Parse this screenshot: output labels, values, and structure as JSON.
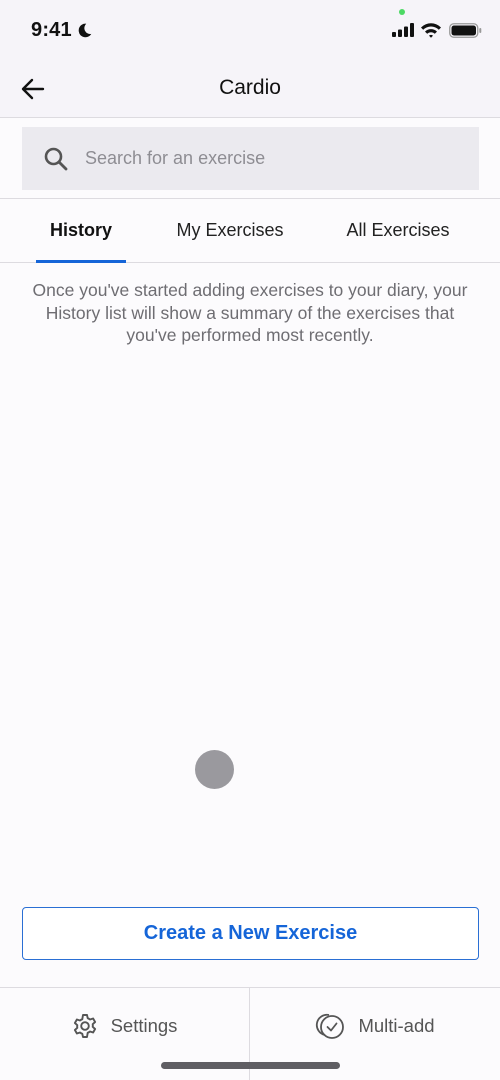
{
  "status_bar": {
    "time": "9:41",
    "icons": [
      "moon-icon",
      "signal-icon",
      "wifi-icon",
      "battery-icon"
    ]
  },
  "nav": {
    "title": "Cardio",
    "back_icon": "arrow-left-icon"
  },
  "search": {
    "placeholder": "Search for an exercise",
    "value": "",
    "icon": "search-icon"
  },
  "tabs": [
    {
      "label": "History",
      "active": true
    },
    {
      "label": "My Exercises",
      "active": false
    },
    {
      "label": "All Exercises",
      "active": false
    }
  ],
  "empty_message": "Once you've started adding exercises to your diary, your History list will show a summary of the exercises that you've performed most recently.",
  "create_button": {
    "label": "Create a New Exercise"
  },
  "bottom_bar": {
    "settings": {
      "label": "Settings",
      "icon": "gear-icon"
    },
    "multi_add": {
      "label": "Multi-add",
      "icon": "multi-check-icon"
    }
  },
  "colors": {
    "accent": "#1565d8",
    "background": "#fcfbfd",
    "header_bg": "#f6f4f9",
    "search_bg": "#ebeaef",
    "muted_text": "#6e6d72"
  }
}
